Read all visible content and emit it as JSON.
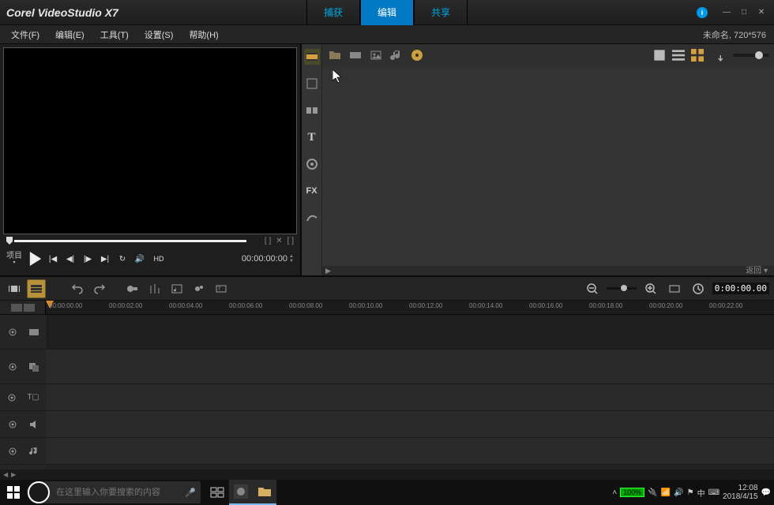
{
  "app": {
    "title": "Corel VideoStudio X7"
  },
  "tabs": {
    "capture": "捕获",
    "edit": "编辑",
    "share": "共享"
  },
  "menu": {
    "file": "文件(F)",
    "edit": "编辑(E)",
    "tools": "工具(T)",
    "settings": "设置(S)",
    "help": "帮助(H)"
  },
  "status": {
    "project": "未命名, 720*576"
  },
  "preview": {
    "mode_label": "项目",
    "hd": "HD",
    "timecode": "00:00:00:00",
    "scrub_icons": {
      "split": "[ ]",
      "cut": "✕",
      "mark": "[ ]"
    }
  },
  "library": {
    "categories": [
      "media",
      "instant",
      "template",
      "title",
      "graphic",
      "fx",
      "path"
    ],
    "footer": "返回 ▾",
    "expand": "▶"
  },
  "timeline": {
    "timecode": "0:00:00.00",
    "ruler": [
      "00:00:00.00",
      "00:00:02.00",
      "00:00:04.00",
      "00:00:06.00",
      "00:00:08.00",
      "00:00:10.00",
      "00:00:12.00",
      "00:00:14.00",
      "00:00:16.00",
      "00:00:18.00",
      "00:00:20.00",
      "00:00:22.00"
    ]
  },
  "taskbar": {
    "search_placeholder": "在这里输入你要搜索的内容",
    "battery": "100%",
    "clock_time": "12:08",
    "clock_date": "2018/4/15",
    "ime": "中"
  }
}
